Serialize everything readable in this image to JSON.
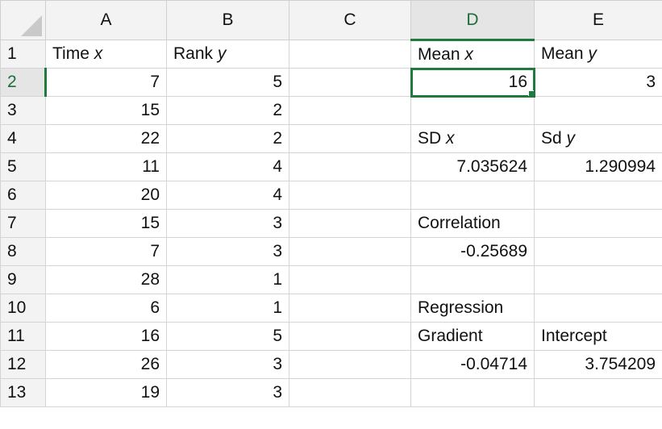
{
  "columns": {
    "A": "A",
    "B": "B",
    "C": "C",
    "D": "D",
    "E": "E"
  },
  "rows": [
    {
      "n": "1",
      "A": "Time ",
      "A_var": "x",
      "B": "Rank ",
      "B_var": "y",
      "D": "Mean ",
      "D_var": "x",
      "E": "Mean ",
      "E_var": "y"
    },
    {
      "n": "2",
      "A": "7",
      "B": "5",
      "D": "16",
      "E": "3"
    },
    {
      "n": "3",
      "A": "15",
      "B": "2"
    },
    {
      "n": "4",
      "A": "22",
      "B": "2",
      "D": "SD ",
      "D_var": "x",
      "E": "Sd ",
      "E_var": "y"
    },
    {
      "n": "5",
      "A": "11",
      "B": "4",
      "D": "7.035624",
      "E": "1.290994"
    },
    {
      "n": "6",
      "A": "20",
      "B": "4"
    },
    {
      "n": "7",
      "A": "15",
      "B": "3",
      "D": "Correlation"
    },
    {
      "n": "8",
      "A": "7",
      "B": "3",
      "D": "-0.25689"
    },
    {
      "n": "9",
      "A": "28",
      "B": "1"
    },
    {
      "n": "10",
      "A": "6",
      "B": "1",
      "D": "Regression"
    },
    {
      "n": "11",
      "A": "16",
      "B": "5",
      "D": "Gradient",
      "E": "Intercept"
    },
    {
      "n": "12",
      "A": "26",
      "B": "3",
      "D": "-0.04714",
      "E": "3.754209"
    },
    {
      "n": "13",
      "A": "19",
      "B": "3"
    }
  ],
  "selection": {
    "cell": "D2"
  }
}
